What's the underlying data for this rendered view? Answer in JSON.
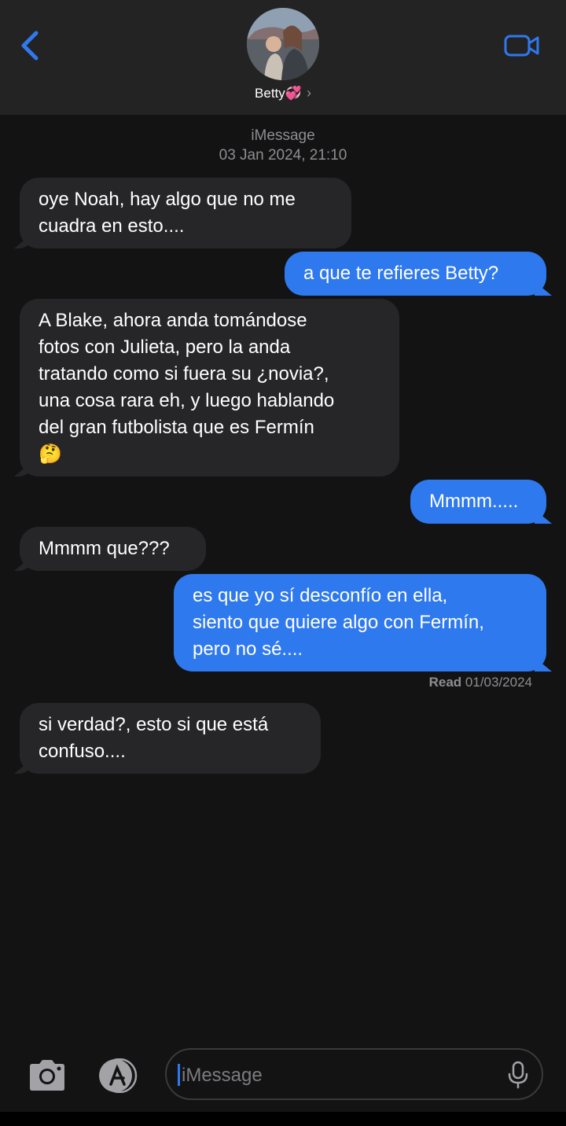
{
  "header": {
    "contact_name": "Betty💞",
    "back_icon": "chevron-left-icon",
    "video_icon": "video-camera-icon",
    "accent_color": "#2f79ee"
  },
  "thread": {
    "service": "iMessage",
    "timestamp": "03 Jan 2024, 21:10",
    "read_label": "Read",
    "read_date": "01/03/2024"
  },
  "messages": [
    {
      "direction": "in",
      "text": "oye Noah, hay algo que no me\ncuadra en esto...."
    },
    {
      "direction": "out",
      "text": "a que te refieres Betty?"
    },
    {
      "direction": "in",
      "text": "A Blake, ahora anda tomándose\nfotos con Julieta, pero la anda\ntratando como si fuera su ¿novia?,\nuna cosa rara eh, y luego hablando\ndel gran futbolista que es Fermín\n🤔"
    },
    {
      "direction": "out",
      "text": "Mmmm....."
    },
    {
      "direction": "in",
      "text": "Mmmm que???"
    },
    {
      "direction": "out",
      "text": "es que yo sí desconfío en ella,\nsiento que quiere algo con Fermín,\npero no sé...."
    },
    {
      "direction": "in",
      "text": "si verdad?, esto si que está\nconfuso...."
    }
  ],
  "composer": {
    "placeholder": "iMessage",
    "camera_icon": "camera-icon",
    "apps_icon": "app-store-icon",
    "mic_icon": "microphone-icon"
  }
}
